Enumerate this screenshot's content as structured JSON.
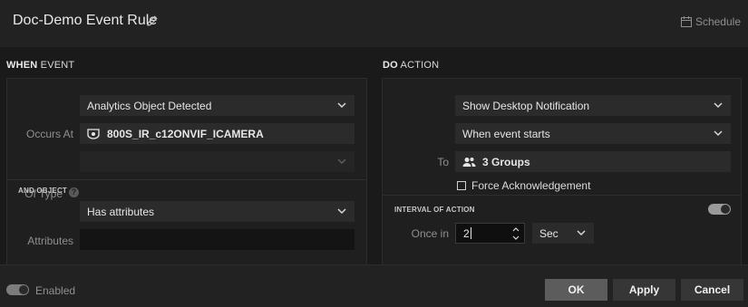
{
  "header": {
    "title": "Doc-Demo Event Rule",
    "schedule_label": "Schedule"
  },
  "when_event": {
    "heading_bold": "WHEN",
    "heading_rest": " EVENT",
    "event_type": "Analytics Object Detected",
    "occurs_at_label": "Occurs At",
    "occurs_at_value": "800S_IR_c12ONVIF_ICAMERA",
    "of_type_label": "Of Type",
    "of_type_help": "?",
    "of_type_value": "",
    "and_object_heading": "AND OBJECT",
    "object_condition": "Has attributes",
    "attributes_label": "Attributes",
    "attributes_value": ""
  },
  "do_action": {
    "heading_bold": "DO",
    "heading_rest": " ACTION",
    "action_type": "Show Desktop Notification",
    "timing": "When event starts",
    "to_label": "To",
    "to_value": "3 Groups",
    "force_ack_label": "Force Acknowledgement",
    "force_ack_checked": false,
    "interval_heading": "INTERVAL OF ACTION",
    "interval_enabled": true,
    "once_in_label": "Once in",
    "once_in_value": "2",
    "unit_value": "Sec"
  },
  "footer": {
    "enabled_label": "Enabled",
    "enabled": true,
    "ok_label": "OK",
    "apply_label": "Apply",
    "cancel_label": "Cancel"
  }
}
